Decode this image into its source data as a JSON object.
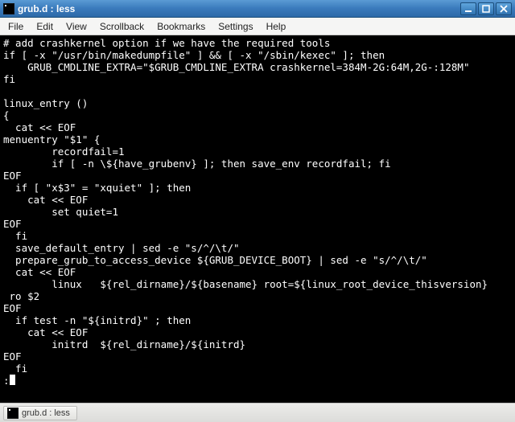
{
  "window": {
    "title": "grub.d : less"
  },
  "menubar": {
    "items": [
      "File",
      "Edit",
      "View",
      "Scrollback",
      "Bookmarks",
      "Settings",
      "Help"
    ]
  },
  "terminal": {
    "lines": [
      "# add crashkernel option if we have the required tools",
      "if [ -x \"/usr/bin/makedumpfile\" ] && [ -x \"/sbin/kexec\" ]; then",
      "    GRUB_CMDLINE_EXTRA=\"$GRUB_CMDLINE_EXTRA crashkernel=384M-2G:64M,2G-:128M\"",
      "fi",
      "",
      "linux_entry ()",
      "{",
      "  cat << EOF",
      "menuentry \"$1\" {",
      "        recordfail=1",
      "        if [ -n \\${have_grubenv} ]; then save_env recordfail; fi",
      "EOF",
      "  if [ \"x$3\" = \"xquiet\" ]; then",
      "    cat << EOF",
      "        set quiet=1",
      "EOF",
      "  fi",
      "  save_default_entry | sed -e \"s/^/\\t/\"",
      "  prepare_grub_to_access_device ${GRUB_DEVICE_BOOT} | sed -e \"s/^/\\t/\"",
      "  cat << EOF",
      "        linux   ${rel_dirname}/${basename} root=${linux_root_device_thisversion}",
      " ro $2",
      "EOF",
      "  if test -n \"${initrd}\" ; then",
      "    cat << EOF",
      "        initrd  ${rel_dirname}/${initrd}",
      "EOF",
      "  fi"
    ],
    "prompt": ":"
  },
  "taskbar": {
    "button_label": "grub.d : less"
  }
}
